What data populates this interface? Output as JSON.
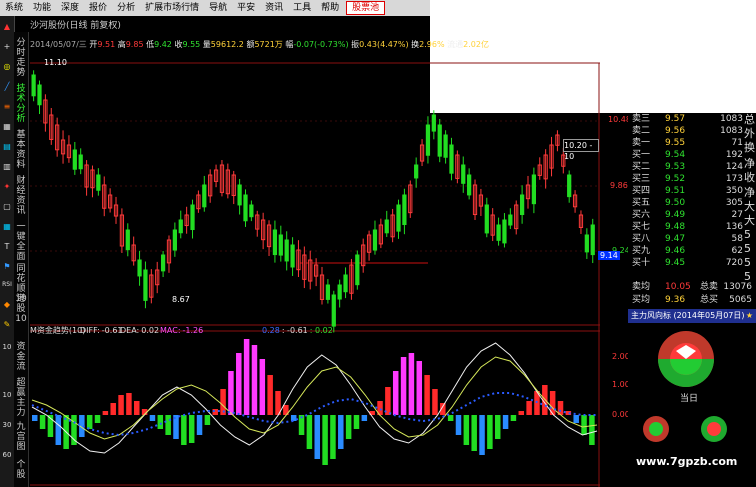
{
  "menu": {
    "items": [
      "系统",
      "功能",
      "深度",
      "报价",
      "分析",
      "扩展市场行情",
      "导航",
      "平安",
      "资讯",
      "工具",
      "帮助"
    ],
    "active": "股票池"
  },
  "chart_title": "沙河股份(日线 前复权)",
  "info": {
    "date": "2014/05/07/三",
    "open_label": "开",
    "open": "9.51",
    "high_label": "高",
    "high": "9.85",
    "low_label": "低",
    "low": "9.42",
    "close_label": "收",
    "close": "9.55",
    "volume_label": "量",
    "volume": "59612.2",
    "amount_label": "额",
    "amount": "5721万",
    "change_label": "幅",
    "change": "-0.07(-0.73%)",
    "amplitude_label": "振",
    "amplitude": "0.43(4.47%)",
    "turnover_label": "换",
    "turnover": "2.96%",
    "float_label": "流通",
    "float": "2.02亿"
  },
  "main_chart": {
    "high_marker": "11.10",
    "low_marker": "8.67",
    "axis_labels": [
      "10.48",
      "9.86",
      "9.24"
    ],
    "current_price": "9.14",
    "price_box": "10.20 - 10"
  },
  "indicator": {
    "name": "M资金趋势(10)",
    "diff_label": "DIFF:",
    "diff": "-0.61",
    "dea_label": "DEA:",
    "dea": "0.02",
    "mac_label": "MAC:",
    "mac": "-1.26",
    "v1": "0.28",
    "v2": ": -0.61",
    "v3": ": 0.02",
    "axis_labels": [
      "2.00",
      "1.00",
      "0.00"
    ]
  },
  "vertical_tabs": [
    "分时走势",
    "技术分析",
    "基本资料",
    "财经资讯",
    "一键全面",
    "同花顺10",
    "港股10",
    "资金流",
    "超赢主力",
    "九宫图",
    "个股"
  ],
  "order_book": {
    "sell": [
      {
        "label": "卖三",
        "price": "9.57",
        "volume": "1083"
      },
      {
        "label": "卖二",
        "price": "9.56",
        "volume": "1083"
      },
      {
        "label": "卖一",
        "price": "9.55",
        "volume": "71"
      }
    ],
    "buy": [
      {
        "label": "买一",
        "price": "9.54",
        "volume": "192"
      },
      {
        "label": "买二",
        "price": "9.53",
        "volume": "124"
      },
      {
        "label": "买三",
        "price": "9.52",
        "volume": "173"
      },
      {
        "label": "买四",
        "price": "9.51",
        "volume": "350"
      },
      {
        "label": "买五",
        "price": "9.50",
        "volume": "305"
      },
      {
        "label": "买六",
        "price": "9.49",
        "volume": "27"
      },
      {
        "label": "买七",
        "price": "9.48",
        "volume": "136"
      },
      {
        "label": "买八",
        "price": "9.47",
        "volume": "58"
      },
      {
        "label": "买九",
        "price": "9.46",
        "volume": "62"
      },
      {
        "label": "买十",
        "price": "9.45",
        "volume": "720"
      }
    ],
    "side_chars": [
      "总",
      "外",
      "换",
      "净",
      "收",
      "净",
      "大",
      "大",
      "5",
      "5",
      "5",
      "5"
    ],
    "sell_avg_label": "卖均",
    "sell_avg": "10.05",
    "sell_total_label": "总卖",
    "sell_total": "13076",
    "buy_avg_label": "买均",
    "buy_avg": "9.36",
    "buy_total_label": "总买",
    "buy_total": "5065"
  },
  "capital_panel": {
    "title": "主力风向标 (2014年05月07日)",
    "today_label": "当日"
  },
  "watermark": "www.7gpzb.com",
  "side_digits": [
    "10",
    "RSI",
    "60",
    "10",
    "30",
    "60",
    "60"
  ]
}
